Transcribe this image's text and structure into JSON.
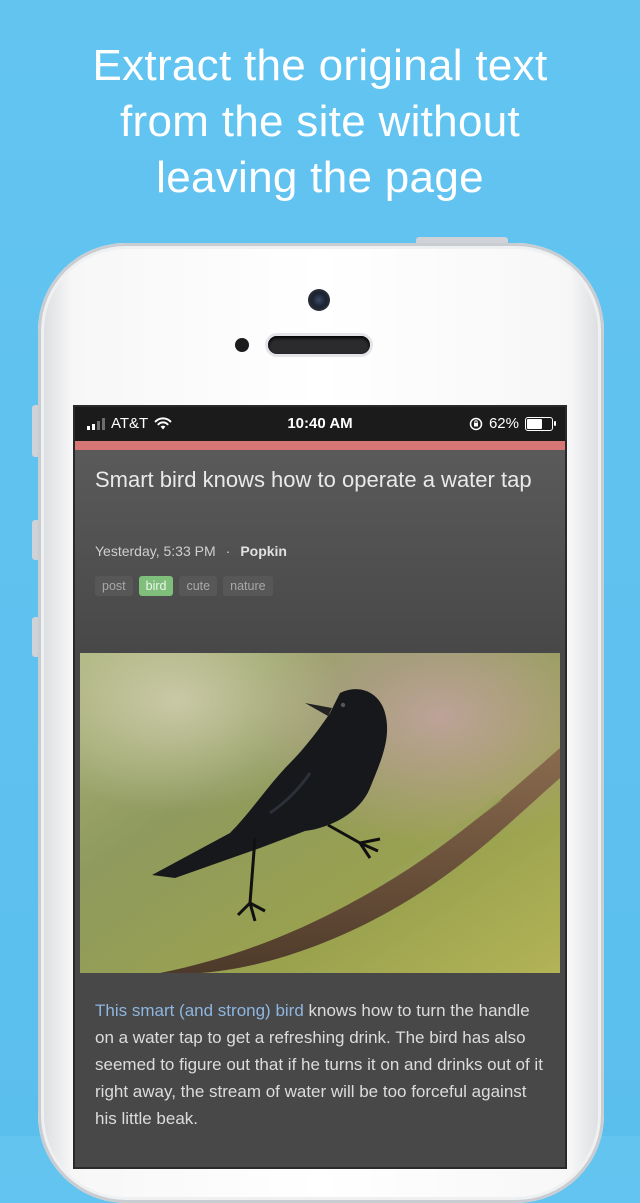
{
  "promo": {
    "headline_line1": "Extract the original text",
    "headline_line2": "from the site without",
    "headline_line3": "leaving the page"
  },
  "status_bar": {
    "carrier": "AT&T",
    "time": "10:40 AM",
    "battery": "62%"
  },
  "article": {
    "title": "Smart bird knows how to operate a water tap",
    "date": "Yesterday, 5:33 PM",
    "separator": "·",
    "author": "Popkin",
    "tags": [
      {
        "label": "post",
        "active": false
      },
      {
        "label": "bird",
        "active": true
      },
      {
        "label": "cute",
        "active": false
      },
      {
        "label": "nature",
        "active": false
      }
    ],
    "body_link": "This smart (and strong) bird",
    "body_text": " knows how to turn the handle on a water tap to get a refreshing drink. The bird has also seemed to figure out that if he turns it on and drinks out of it right away, the stream of water will be too forceful against his little beak."
  },
  "colors": {
    "background": "#5fc2ef",
    "accent_strip": "#d77775",
    "active_tag": "#7fbf7b",
    "link": "#8eb6e0"
  }
}
